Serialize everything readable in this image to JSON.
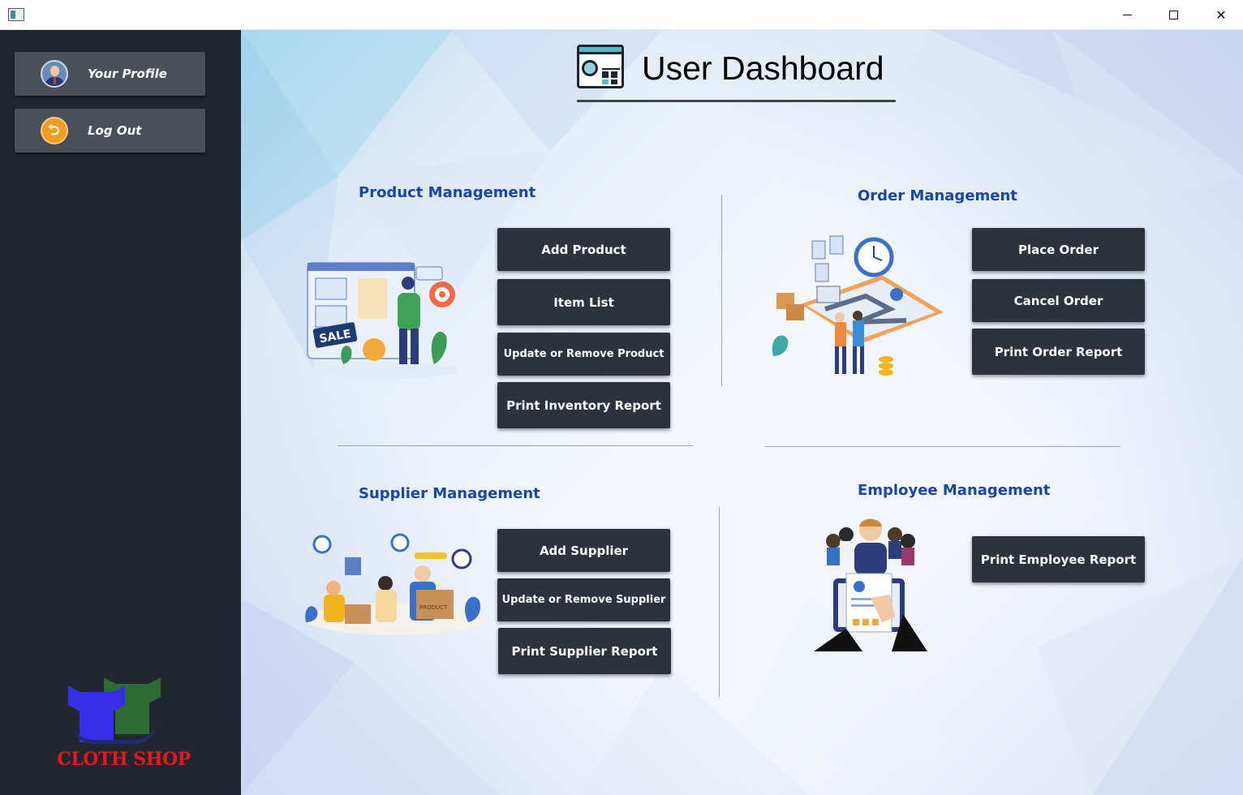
{
  "window": {
    "minimize_symbol": "",
    "close_symbol": "✕"
  },
  "sidebar": {
    "profile_label": "Your Profile",
    "logout_label": "Log Out",
    "logo_text": "CLOTH SHOP",
    "colors": {
      "background": "#22262f",
      "button": "#4b4f58"
    }
  },
  "header": {
    "title": "User Dashboard"
  },
  "sections": {
    "product": {
      "title": "Product Management",
      "buttons": {
        "add": "Add Product",
        "list": "Item List",
        "update": "Update or Remove Product",
        "report": "Print Inventory Report"
      }
    },
    "order": {
      "title": "Order Management",
      "buttons": {
        "place": "Place Order",
        "cancel": "Cancel Order",
        "report": "Print Order Report"
      }
    },
    "supplier": {
      "title": "Supplier Management",
      "buttons": {
        "add": "Add Supplier",
        "update": "Update or Remove Supplier",
        "report": "Print Supplier Report"
      }
    },
    "employee": {
      "title": "Employee Management",
      "buttons": {
        "report": "Print Employee Report"
      }
    }
  },
  "illustration_texts": {
    "sale_tag": "SALE",
    "product_box": "PRODUCT"
  },
  "colors": {
    "section_title": "#1746a6",
    "action_button": "#2e323d",
    "logo_text": "#e11b1b"
  }
}
